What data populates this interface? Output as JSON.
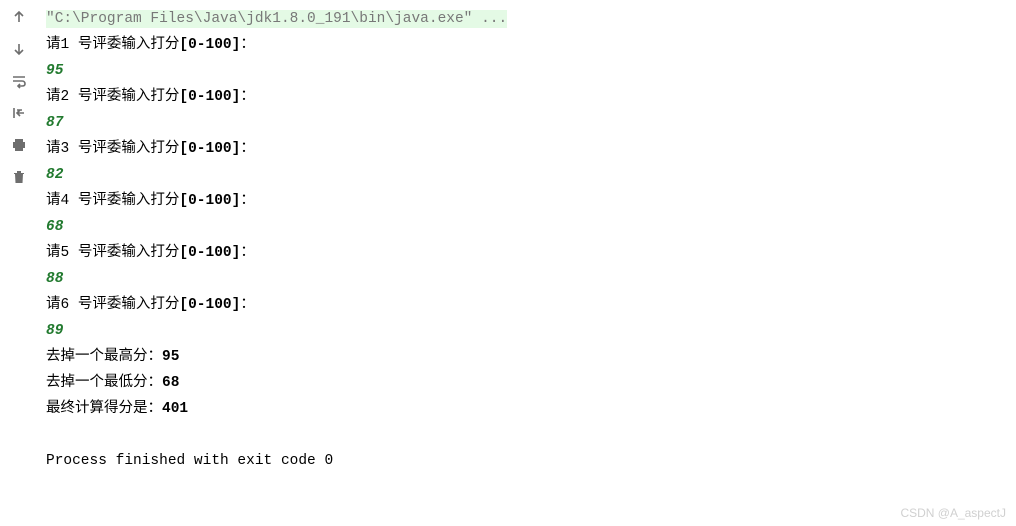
{
  "toolbar": {
    "icons": [
      "arrow-up",
      "arrow-down",
      "soft-wrap",
      "scroll-to-end",
      "print",
      "delete"
    ]
  },
  "console": {
    "command": "\"C:\\Program Files\\Java\\jdk1.8.0_191\\bin\\java.exe\" ...",
    "prompts": [
      {
        "prefix": "请1 号评委输入打分",
        "range": "[0-100]",
        "suffix": "：",
        "input": "95"
      },
      {
        "prefix": "请2 号评委输入打分",
        "range": "[0-100]",
        "suffix": "：",
        "input": "87"
      },
      {
        "prefix": "请3 号评委输入打分",
        "range": "[0-100]",
        "suffix": "：",
        "input": "82"
      },
      {
        "prefix": "请4 号评委输入打分",
        "range": "[0-100]",
        "suffix": "：",
        "input": "68"
      },
      {
        "prefix": "请5 号评委输入打分",
        "range": "[0-100]",
        "suffix": "：",
        "input": "88"
      },
      {
        "prefix": "请6 号评委输入打分",
        "range": "[0-100]",
        "suffix": "：",
        "input": "89"
      }
    ],
    "results": [
      {
        "label": "去掉一个最高分：",
        "value": "95"
      },
      {
        "label": "去掉一个最低分：",
        "value": "68"
      },
      {
        "label": "最终计算得分是：",
        "value": "401"
      }
    ],
    "exit": "Process finished with exit code 0"
  },
  "watermark": "CSDN @A_aspectJ"
}
